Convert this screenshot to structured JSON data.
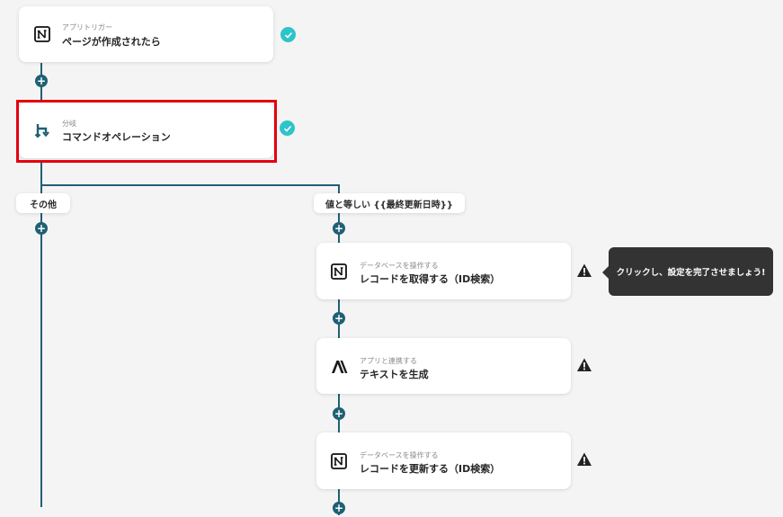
{
  "nodes": {
    "trigger": {
      "category": "アプリトリガー",
      "title": "ページが作成されたら",
      "icon": "notion-icon"
    },
    "branch": {
      "category": "分岐",
      "title": "コマンドオペレーション",
      "icon": "branch-icon"
    },
    "get_record": {
      "category": "データベースを操作する",
      "title": "レコードを取得する（ID検索）",
      "icon": "notion-icon"
    },
    "gen_text": {
      "category": "アプリと連携する",
      "title": "テキストを生成",
      "icon": "anthropic-icon"
    },
    "update_record": {
      "category": "データベースを操作する",
      "title": "レコードを更新する（ID検索）",
      "icon": "notion-icon"
    }
  },
  "branches": {
    "left_label": "その他",
    "right_label": "値と等しい {{最終更新日時}}"
  },
  "tooltip": {
    "text": "クリックし、設定を完了させましょう!"
  },
  "colors": {
    "line": "#1f6074",
    "check": "#2ec4c9",
    "highlight": "#e3000f",
    "tooltip_bg": "#333333",
    "background": "#f4f4f4"
  }
}
